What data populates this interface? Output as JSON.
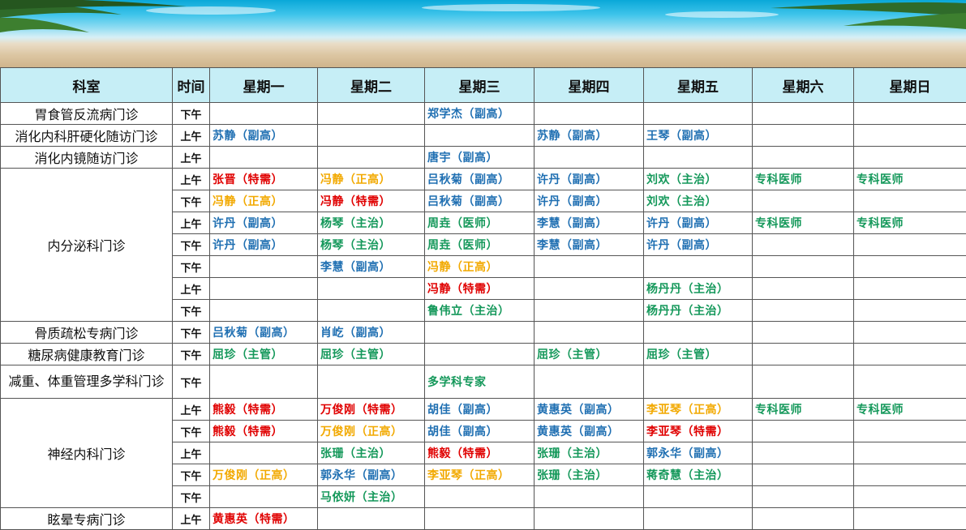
{
  "colors": {
    "blue": "#1f6fb2",
    "green": "#14985a",
    "red": "#e00000",
    "orange": "#f2a900",
    "header_bg": "#c6eef6"
  },
  "headers": {
    "dept": "科室",
    "time": "时间",
    "days": [
      "星期一",
      "星期二",
      "星期三",
      "星期四",
      "星期五",
      "星期六",
      "星期日"
    ]
  },
  "depts": [
    "胃食管反流病门诊",
    "消化内科肝硬化随访门诊",
    "消化内镜随访门诊",
    "内分泌科门诊",
    "骨质疏松专病门诊",
    "糖尿病健康教育门诊",
    "减重、体重管理多学科门诊",
    "神经内科门诊",
    "眩晕专病门诊"
  ],
  "rows": [
    {
      "time": "下午",
      "cells": [
        {
          "t": ""
        },
        {
          "t": ""
        },
        {
          "t": "郑学杰（副高）",
          "c": "blue"
        },
        {
          "t": ""
        },
        {
          "t": ""
        },
        {
          "t": ""
        },
        {
          "t": ""
        }
      ]
    },
    {
      "time": "上午",
      "cells": [
        {
          "t": "苏静（副高）",
          "c": "blue"
        },
        {
          "t": ""
        },
        {
          "t": ""
        },
        {
          "t": "苏静（副高）",
          "c": "blue"
        },
        {
          "t": "王琴（副高）",
          "c": "blue"
        },
        {
          "t": ""
        },
        {
          "t": ""
        }
      ]
    },
    {
      "time": "上午",
      "cells": [
        {
          "t": ""
        },
        {
          "t": ""
        },
        {
          "t": "唐宇（副高）",
          "c": "blue"
        },
        {
          "t": ""
        },
        {
          "t": ""
        },
        {
          "t": ""
        },
        {
          "t": ""
        }
      ]
    },
    {
      "time": "上午",
      "cells": [
        {
          "t": "张晋（特需）",
          "c": "red"
        },
        {
          "t": "冯静（正高）",
          "c": "orange"
        },
        {
          "t": "吕秋菊（副高）",
          "c": "blue"
        },
        {
          "t": "许丹（副高）",
          "c": "blue"
        },
        {
          "t": "刘欢（主治）",
          "c": "green"
        },
        {
          "t": "专科医师",
          "c": "green"
        },
        {
          "t": "专科医师",
          "c": "green"
        }
      ]
    },
    {
      "time": "下午",
      "cells": [
        {
          "t": "冯静（正高）",
          "c": "orange"
        },
        {
          "t": "冯静（特需）",
          "c": "red"
        },
        {
          "t": "吕秋菊（副高）",
          "c": "blue"
        },
        {
          "t": "许丹（副高）",
          "c": "blue"
        },
        {
          "t": "刘欢（主治）",
          "c": "green"
        },
        {
          "t": ""
        },
        {
          "t": ""
        }
      ]
    },
    {
      "time": "上午",
      "cells": [
        {
          "t": "许丹（副高）",
          "c": "blue"
        },
        {
          "t": "杨琴（主治）",
          "c": "green"
        },
        {
          "t": "周垚（医师）",
          "c": "green"
        },
        {
          "t": "李慧（副高）",
          "c": "blue"
        },
        {
          "t": "许丹（副高）",
          "c": "blue"
        },
        {
          "t": "专科医师",
          "c": "green"
        },
        {
          "t": "专科医师",
          "c": "green"
        }
      ]
    },
    {
      "time": "下午",
      "cells": [
        {
          "t": "许丹（副高）",
          "c": "blue"
        },
        {
          "t": "杨琴（主治）",
          "c": "green"
        },
        {
          "t": "周垚（医师）",
          "c": "green"
        },
        {
          "t": "李慧（副高）",
          "c": "blue"
        },
        {
          "t": "许丹（副高）",
          "c": "blue"
        },
        {
          "t": ""
        },
        {
          "t": ""
        }
      ]
    },
    {
      "time": "下午",
      "cells": [
        {
          "t": ""
        },
        {
          "t": "李慧（副高）",
          "c": "blue"
        },
        {
          "t": "冯静（正高）",
          "c": "orange"
        },
        {
          "t": ""
        },
        {
          "t": ""
        },
        {
          "t": ""
        },
        {
          "t": ""
        }
      ]
    },
    {
      "time": "上午",
      "cells": [
        {
          "t": ""
        },
        {
          "t": ""
        },
        {
          "t": "冯静（特需）",
          "c": "red"
        },
        {
          "t": ""
        },
        {
          "t": "杨丹丹（主治）",
          "c": "green"
        },
        {
          "t": ""
        },
        {
          "t": ""
        }
      ]
    },
    {
      "time": "下午",
      "cells": [
        {
          "t": ""
        },
        {
          "t": ""
        },
        {
          "t": "鲁伟立（主治）",
          "c": "green"
        },
        {
          "t": ""
        },
        {
          "t": "杨丹丹（主治）",
          "c": "green"
        },
        {
          "t": ""
        },
        {
          "t": ""
        }
      ]
    },
    {
      "time": "下午",
      "cells": [
        {
          "t": "吕秋菊（副高）",
          "c": "blue"
        },
        {
          "t": "肖屹（副高）",
          "c": "blue"
        },
        {
          "t": ""
        },
        {
          "t": ""
        },
        {
          "t": ""
        },
        {
          "t": ""
        },
        {
          "t": ""
        }
      ]
    },
    {
      "time": "下午",
      "cells": [
        {
          "t": "屈珍（主管）",
          "c": "green"
        },
        {
          "t": "屈珍（主管）",
          "c": "green"
        },
        {
          "t": ""
        },
        {
          "t": "屈珍（主管）",
          "c": "green"
        },
        {
          "t": "屈珍（主管）",
          "c": "green"
        },
        {
          "t": ""
        },
        {
          "t": ""
        }
      ]
    },
    {
      "time": "下午",
      "cells": [
        {
          "t": ""
        },
        {
          "t": ""
        },
        {
          "t": "多学科专家",
          "c": "green"
        },
        {
          "t": ""
        },
        {
          "t": ""
        },
        {
          "t": ""
        },
        {
          "t": ""
        }
      ]
    },
    {
      "time": "上午",
      "cells": [
        {
          "t": "熊毅（特需）",
          "c": "red"
        },
        {
          "t": "万俊刚（特需）",
          "c": "red"
        },
        {
          "t": "胡佳（副高）",
          "c": "blue"
        },
        {
          "t": "黄惠英（副高）",
          "c": "blue"
        },
        {
          "t": "李亚琴（正高）",
          "c": "orange"
        },
        {
          "t": "专科医师",
          "c": "green"
        },
        {
          "t": "专科医师",
          "c": "green"
        }
      ]
    },
    {
      "time": "下午",
      "cells": [
        {
          "t": "熊毅（特需）",
          "c": "red"
        },
        {
          "t": "万俊刚（正高）",
          "c": "orange"
        },
        {
          "t": "胡佳（副高）",
          "c": "blue"
        },
        {
          "t": "黄惠英（副高）",
          "c": "blue"
        },
        {
          "t": "李亚琴（特需）",
          "c": "red"
        },
        {
          "t": ""
        },
        {
          "t": ""
        }
      ]
    },
    {
      "time": "上午",
      "cells": [
        {
          "t": ""
        },
        {
          "t": "张珊（主治）",
          "c": "green"
        },
        {
          "t": "熊毅（特需）",
          "c": "red"
        },
        {
          "t": "张珊（主治）",
          "c": "green"
        },
        {
          "t": "郭永华（副高）",
          "c": "blue"
        },
        {
          "t": ""
        },
        {
          "t": ""
        }
      ]
    },
    {
      "time": "下午",
      "cells": [
        {
          "t": "万俊刚（正高）",
          "c": "orange"
        },
        {
          "t": "郭永华（副高）",
          "c": "blue"
        },
        {
          "t": "李亚琴（正高）",
          "c": "orange"
        },
        {
          "t": "张珊（主治）",
          "c": "green"
        },
        {
          "t": "蒋奇慧（主治）",
          "c": "green"
        },
        {
          "t": ""
        },
        {
          "t": ""
        }
      ]
    },
    {
      "time": "下午",
      "cells": [
        {
          "t": ""
        },
        {
          "t": "马依妍（主治）",
          "c": "green"
        },
        {
          "t": ""
        },
        {
          "t": ""
        },
        {
          "t": ""
        },
        {
          "t": ""
        },
        {
          "t": ""
        }
      ]
    },
    {
      "time": "上午",
      "cells": [
        {
          "t": "黄惠英（特需）",
          "c": "red"
        },
        {
          "t": ""
        },
        {
          "t": ""
        },
        {
          "t": ""
        },
        {
          "t": ""
        },
        {
          "t": ""
        },
        {
          "t": ""
        }
      ]
    }
  ]
}
